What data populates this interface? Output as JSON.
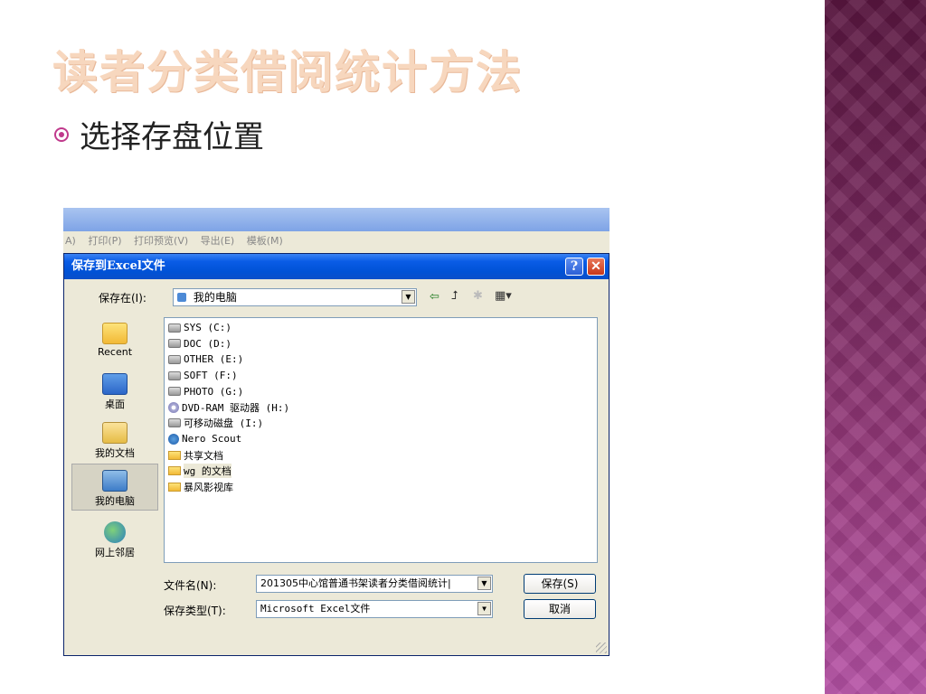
{
  "slide": {
    "title": "读者分类借阅统计方法",
    "bullet": "选择存盘位置"
  },
  "app": {
    "menu": [
      "A)",
      "打印(P)",
      "打印预览(V)",
      "导出(E)",
      "模板(M)"
    ]
  },
  "dialog": {
    "title": "保存到Excel文件",
    "help_label": "?",
    "close_label": "✕",
    "save_in_label": "保存在(I):",
    "save_in_value": "我的电脑",
    "places": [
      {
        "label": "Recent",
        "icon": "recent-folder-icon"
      },
      {
        "label": "桌面",
        "icon": "desktop-icon"
      },
      {
        "label": "我的文档",
        "icon": "my-documents-icon"
      },
      {
        "label": "我的电脑",
        "icon": "my-computer-icon"
      },
      {
        "label": "网上邻居",
        "icon": "network-places-icon"
      }
    ],
    "files": [
      {
        "name": "SYS (C:)",
        "icon": "drive-icon"
      },
      {
        "name": "DOC (D:)",
        "icon": "drive-icon"
      },
      {
        "name": "OTHER (E:)",
        "icon": "drive-icon"
      },
      {
        "name": "SOFT (F:)",
        "icon": "drive-icon"
      },
      {
        "name": "PHOTO (G:)",
        "icon": "drive-icon"
      },
      {
        "name": "DVD-RAM 驱动器 (H:)",
        "icon": "dvd-drive-icon"
      },
      {
        "name": "可移动磁盘 (I:)",
        "icon": "removable-disk-icon"
      },
      {
        "name": "Nero Scout",
        "icon": "nero-scout-icon"
      },
      {
        "name": "共享文档",
        "icon": "folder-icon"
      },
      {
        "name": "wg 的文档",
        "icon": "folder-icon"
      },
      {
        "name": "暴风影视库",
        "icon": "folder-icon"
      }
    ],
    "filename_label": "文件名(N):",
    "filename_value": "201305中心馆普通书架读者分类借阅统计|",
    "filetype_label": "保存类型(T):",
    "filetype_value": "Microsoft Excel文件",
    "save_button": "保存(S)",
    "cancel_button": "取消"
  }
}
